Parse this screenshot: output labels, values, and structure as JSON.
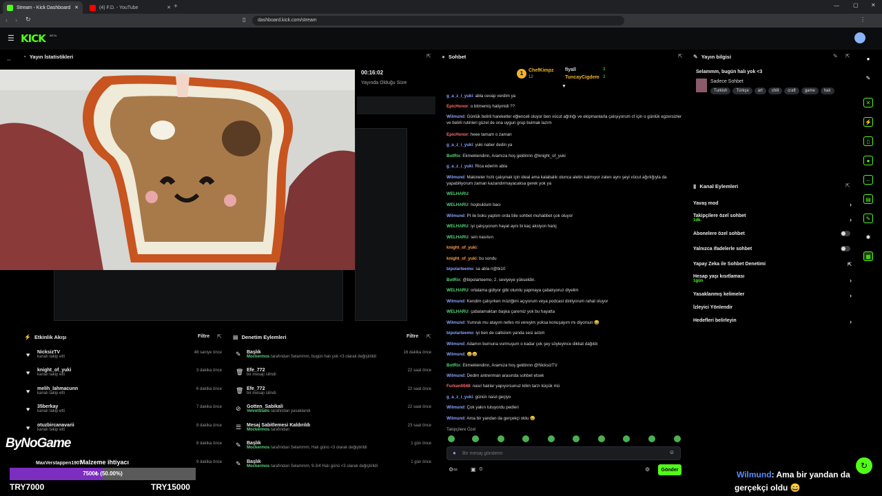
{
  "browser": {
    "tabs": [
      {
        "title": "Stream - Kick Dashboard",
        "active": true
      },
      {
        "title": "(4) F.D. - YouTube",
        "active": false
      }
    ],
    "url": "dashboard.kick.com/stream"
  },
  "kick": {
    "logo": "KICK",
    "beta": "BETA"
  },
  "stats": {
    "title": "Yayın İstatistikleri",
    "duration": "00:16:02",
    "duration_label": "Yayında Olduğu Süre"
  },
  "activity": {
    "title": "Etkinlik Akışı",
    "filter": "Filtre",
    "items": [
      {
        "name": "NicksizTV",
        "sub": "kanalı takip etti",
        "time": "48 saniye önce"
      },
      {
        "name": "knight_of_yuki",
        "sub": "kanalı takip etti",
        "time": "3 dakika önce"
      },
      {
        "name": "melih_lahmacunn",
        "sub": "kanalı takip etti",
        "time": "6 dakika önce"
      },
      {
        "name": "35berkay",
        "sub": "kanalı takip etti",
        "time": "7 dakika önce"
      },
      {
        "name": "otuzbircanavarii",
        "sub": "kanalı takip etti",
        "time": "8 dakika önce"
      },
      {
        "name": "",
        "sub": "",
        "time": "8 dakika önce"
      },
      {
        "name": "MaxVerstappen1907",
        "sub": "",
        "time": "9 dakika önce"
      }
    ]
  },
  "moderation": {
    "title": "Denetim Eylemleri",
    "filter": "Filtre",
    "items": [
      {
        "title": "Başlık",
        "who": "Mockermos",
        "text": " tarafından Selammm, bugün halı yok <3 olarak değiştirildi",
        "time": "16 dakika önce"
      },
      {
        "title": "Efe_772",
        "who": "",
        "text": "bir mesajı silindi",
        "time": "22 saat önce"
      },
      {
        "title": "Efe_772",
        "who": "",
        "text": "bir mesajı silindi",
        "time": "22 saat önce"
      },
      {
        "title": "Gotten_Sabikali",
        "who": "VelvetStatic",
        "text": " tarafından yasaklandı",
        "time": "22 saat önce"
      },
      {
        "title": "Mesaj Sabitlemesi Kaldırıldı",
        "who": "Mockermos",
        "text": " tarafından",
        "time": "23 saat önce"
      },
      {
        "title": "Başlık",
        "who": "Mockermos",
        "text": " tarafından Selammm, Halı günü <3 olarak değiştirildi",
        "time": "1 gün önce"
      },
      {
        "title": "Başlık",
        "who": "Mockermos",
        "text": " tarafından Selammm, 9-3/4 Halı günü <3 olarak değiştirildi",
        "time": "1 gün önce"
      }
    ]
  },
  "chat": {
    "title": "Sohbet",
    "leaderboard": [
      {
        "name": "ChefKimpz",
        "count": "12"
      },
      {
        "name": "fiyall",
        "count": "3"
      },
      {
        "name": "TuncayCigdem",
        "count": "2"
      }
    ],
    "messages": [
      {
        "user": "g_a_z_i_yuki",
        "color": "u-blue",
        "text": "abla cevap verdim ya"
      },
      {
        "user": "EpicHonor",
        "color": "u-red",
        "text": "o bitmemiş haliymidi ??"
      },
      {
        "user": "Wilmund",
        "color": "u-blue",
        "text": "Günlük belirli hareketler eğlenceli oluyor ben vücut ağrılığı ve ekipmanlarla çalışıyorum cf için o günlük egzersizler ve belirli rutinleri güzel de ona uygun grup bulmak lazım"
      },
      {
        "user": "EpicHonor",
        "color": "u-red",
        "text": "heee tamam o zaman"
      },
      {
        "user": "g_a_z_i_yuki",
        "color": "u-blue",
        "text": "yuki naber dedin ya"
      },
      {
        "user": "BotRix",
        "color": "u-green",
        "text": "Ekmeklendinn, Aramıza hoş geldinnn @knight_of_yuki"
      },
      {
        "user": "g_a_z_i_yuki",
        "color": "u-blue",
        "text": "Rica ederim abla"
      },
      {
        "user": "Wilmund",
        "color": "u-blue",
        "text": "Makineler hızlı çalışmak için ideal ama kalabalık olunca aletin kalmıyor zaten aynı şeyi vücut ağırlığıyla da yapabiliyorum zaman kazandırmayacaksa gerek yok ya"
      },
      {
        "user": "WELHARU",
        "color": "u-green",
        "text": ""
      },
      {
        "user": "WELHARU",
        "color": "u-green",
        "text": "hoşbuldum bacı"
      },
      {
        "user": "Wilmund",
        "color": "u-blue",
        "text": "Pt ile boks yaptım orda bile sohbet muhabbet çok oluyor"
      },
      {
        "user": "WELHARU",
        "color": "u-green",
        "text": "iyi çalışıyorum hayat aynı bi kaç aksiyon hariç"
      },
      {
        "user": "WELHARU",
        "color": "u-green",
        "text": "sen nasılsın"
      },
      {
        "user": "knight_of_yuki",
        "color": "u-orange",
        "text": ""
      },
      {
        "user": "knight_of_yuki",
        "color": "u-orange",
        "text": "bu sondu"
      },
      {
        "user": "bipolarteemo",
        "color": "u-blue",
        "text": "sa abla n@bi10"
      },
      {
        "user": "BotRix",
        "color": "u-green",
        "text": "@bipolarteemo, 2. seviyeye yükseldin."
      },
      {
        "user": "WELHARU",
        "color": "u-green",
        "text": "ortalama gidiyor gibi olumlu yapmaya çabalıyoruz diyelim"
      },
      {
        "user": "Wilmund",
        "color": "u-blue",
        "text": "Kendim çalışırken müziğimi açıyorum veya podcast dinliyorum rahat oluyor"
      },
      {
        "user": "WELHARU",
        "color": "u-green",
        "text": "çabalamaktan başka çaremiz yok bu hayatta"
      },
      {
        "user": "Wilmund",
        "color": "u-blue",
        "text": "Yumruk mu atayım nefes mi vereyim yoksa konuşayım mı diyorsun 😄"
      },
      {
        "user": "bipolarteemo",
        "color": "u-blue",
        "text": "iyi ben de callislom yanda sesi actım"
      },
      {
        "user": "Wilmund",
        "color": "u-blue",
        "text": "Adamın burnuna vurmuşum o kadar çok şey söyleyince dikkat dağıldı"
      },
      {
        "user": "Wilmund",
        "color": "u-blue",
        "text": "😄😄"
      },
      {
        "user": "BotRix",
        "color": "u-green",
        "text": "Ekmeklendinn, Aramıza hoş geldinnn @NicksizTV"
      },
      {
        "user": "Wilmund",
        "color": "u-blue",
        "text": "Dedim antrenman arasında sohbet etsek"
      },
      {
        "user": "Furkan0048",
        "color": "u-red",
        "text": "nasıl halılar yapıyorsunuz kilim tarzı küçük mü"
      },
      {
        "user": "g_a_z_i_yuki",
        "color": "u-blue",
        "text": "günün nasıl geçiyo"
      },
      {
        "user": "Wilmund",
        "color": "u-blue",
        "text": "Çok yakın tutuyordu pedleri"
      },
      {
        "user": "Wilmund",
        "color": "u-blue",
        "text": "Ama bir yandan da gerçekçi oldu 😄"
      }
    ],
    "followers_only": "Takipçilere Özel",
    "placeholder": "Bir mesaj gönderin",
    "send": "Gönder",
    "viewer_count": "0"
  },
  "stream_info": {
    "title": "Yayın bilgisi",
    "stream_title": "Selammm, bugün halı yok <3",
    "category": "Sadece Sohbet",
    "tags": [
      "Turkish",
      "Türkçe",
      "art",
      "chill",
      "craft",
      "game",
      "halı"
    ]
  },
  "channel_actions": {
    "title": "Kanal Eylemleri",
    "items": [
      {
        "label": "Yavaş mod",
        "sub": "",
        "control": "chevron"
      },
      {
        "label": "Takipçilere özel sohbet",
        "sub": "1dk.",
        "control": "chevron"
      },
      {
        "label": "Abonelere özel sohbet",
        "sub": "",
        "control": "toggle"
      },
      {
        "label": "Yalnızca ifadelerle sohbet",
        "sub": "",
        "control": "toggle"
      },
      {
        "label": "Yapay Zeka ile Sohbet Denetimi",
        "sub": "",
        "control": "external"
      },
      {
        "label": "Hesap yaşı kısıtlaması",
        "sub": "1gün",
        "control": "chevron"
      },
      {
        "label": "Yasaklanmış kelimeler",
        "sub": "",
        "control": "chevron"
      },
      {
        "label": "İzleyici Yönlendir",
        "sub": "",
        "control": "none"
      },
      {
        "label": "Hedefleri belirleyin",
        "sub": "",
        "control": "chevron"
      }
    ]
  },
  "overlay": {
    "brand": "ByNoGame",
    "goal_label": "Malzeme ihtiyacı",
    "goal_progress_text": "7500₺ (50.00%)",
    "goal_progress": 0.5,
    "goal_min": "TRY7000",
    "goal_max": "TRY15000",
    "ticker_user": "Wilmund",
    "ticker_text": ": Ama bir yandan da",
    "ticker_text2": "gerçekçi oldu 😄"
  }
}
